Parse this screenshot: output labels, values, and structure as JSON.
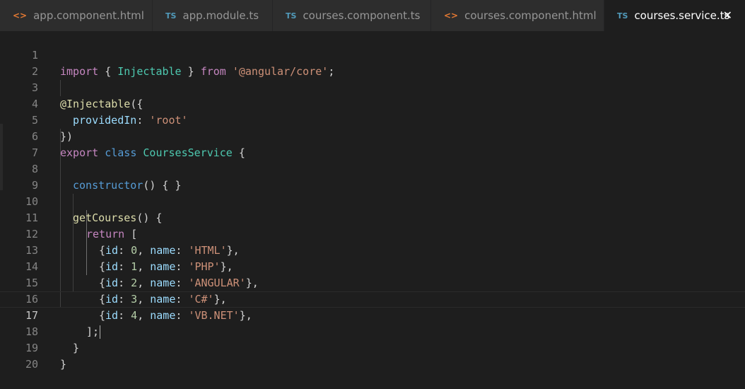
{
  "tabs": [
    {
      "icon": "<>",
      "label": "app.component.html"
    },
    {
      "icon": "TS",
      "label": "app.module.ts"
    },
    {
      "icon": "TS",
      "label": "courses.component.ts"
    },
    {
      "icon": "<>",
      "label": "courses.component.html"
    },
    {
      "icon": "TS",
      "label": "courses.service.ts",
      "close": "✕"
    }
  ],
  "editor": {
    "line_numbers": [
      "1",
      "2",
      "3",
      "4",
      "5",
      "6",
      "7",
      "8",
      "9",
      "10",
      "11",
      "12",
      "13",
      "14",
      "15",
      "16",
      "17",
      "18",
      "19",
      "20"
    ],
    "current_line": "17",
    "code": {
      "l1": {
        "import": "import",
        "ob": " { ",
        "injectable": "Injectable",
        "cb": " } ",
        "from": "from",
        "sp": " ",
        "module": "'@angular/core'",
        "semi": ";"
      },
      "l3": {
        "decorator": "@Injectable",
        "open": "({"
      },
      "l4": {
        "key": "providedIn",
        "colon": ": ",
        "val": "'root'"
      },
      "l5": {
        "close": "})"
      },
      "l6": {
        "export": "export",
        "sp1": " ",
        "class": "class",
        "sp2": " ",
        "name": "CoursesService",
        "brace": " {"
      },
      "l8": {
        "ctor": "constructor",
        "rest": "() { }"
      },
      "l10": {
        "method": "getCourses",
        "rest": "() {"
      },
      "l11": {
        "ret": "return",
        "bracket": " ["
      },
      "items": [
        {
          "open": "{",
          "id_key": "id",
          "c1": ": ",
          "id_val": "0",
          "comma": ", ",
          "name_key": "name",
          "c2": ": ",
          "name_val": "'HTML'",
          "close": "},"
        },
        {
          "open": "{",
          "id_key": "id",
          "c1": ": ",
          "id_val": "1",
          "comma": ", ",
          "name_key": "name",
          "c2": ": ",
          "name_val": "'PHP'",
          "close": "},"
        },
        {
          "open": "{",
          "id_key": "id",
          "c1": ": ",
          "id_val": "2",
          "comma": ", ",
          "name_key": "name",
          "c2": ": ",
          "name_val": "'ANGULAR'",
          "close": "},"
        },
        {
          "open": "{",
          "id_key": "id",
          "c1": ": ",
          "id_val": "3",
          "comma": ", ",
          "name_key": "name",
          "c2": ": ",
          "name_val": "'C#'",
          "close": "},"
        },
        {
          "open": "{",
          "id_key": "id",
          "c1": ": ",
          "id_val": "4",
          "comma": ", ",
          "name_key": "name",
          "c2": ": ",
          "name_val": "'VB.NET'",
          "close": "},"
        }
      ],
      "l17": {
        "text": "];"
      },
      "l18": {
        "text": "}"
      },
      "l19": {
        "text": "}"
      }
    }
  },
  "colors": {
    "background": "#1e1e1e",
    "keyword": "#569cd6",
    "control": "#c586c0",
    "type": "#4ec9b0",
    "function": "#dcdcaa",
    "property": "#9cdcfe",
    "string": "#ce9178",
    "number": "#b5cea8"
  }
}
